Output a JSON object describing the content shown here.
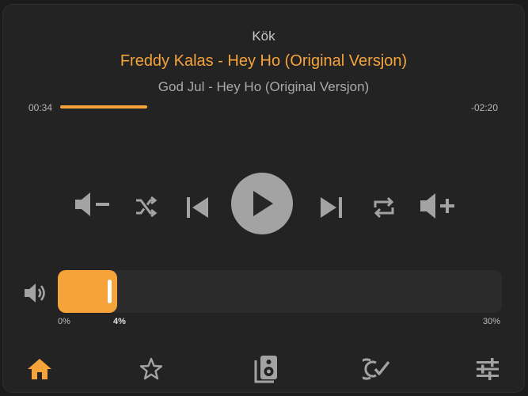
{
  "player": {
    "room": "Kök",
    "title": "Freddy Kalas - Hey Ho (Original Versjon)",
    "subtitle": "God Jul - Hey Ho (Original Versjon)",
    "time_elapsed": "00:34",
    "time_remaining": "-02:20",
    "progress_fraction": 0.2
  },
  "controls": {
    "icons": [
      "volume-down-icon",
      "shuffle-icon",
      "previous-icon",
      "play-icon",
      "next-icon",
      "repeat-icon",
      "volume-up-icon"
    ]
  },
  "volume": {
    "min_label": "0%",
    "current_label": "4%",
    "max_label": "30%",
    "level_fraction": 0.134
  },
  "nav": {
    "items": [
      "home-icon",
      "favorites-icon",
      "speaker-icon",
      "playlists-icon",
      "settings-icon"
    ],
    "active": "home-icon"
  },
  "colors": {
    "accent": "#f5a33a",
    "background": "#232323",
    "icon": "#a3a3a3",
    "track": "#2b2b2b"
  }
}
